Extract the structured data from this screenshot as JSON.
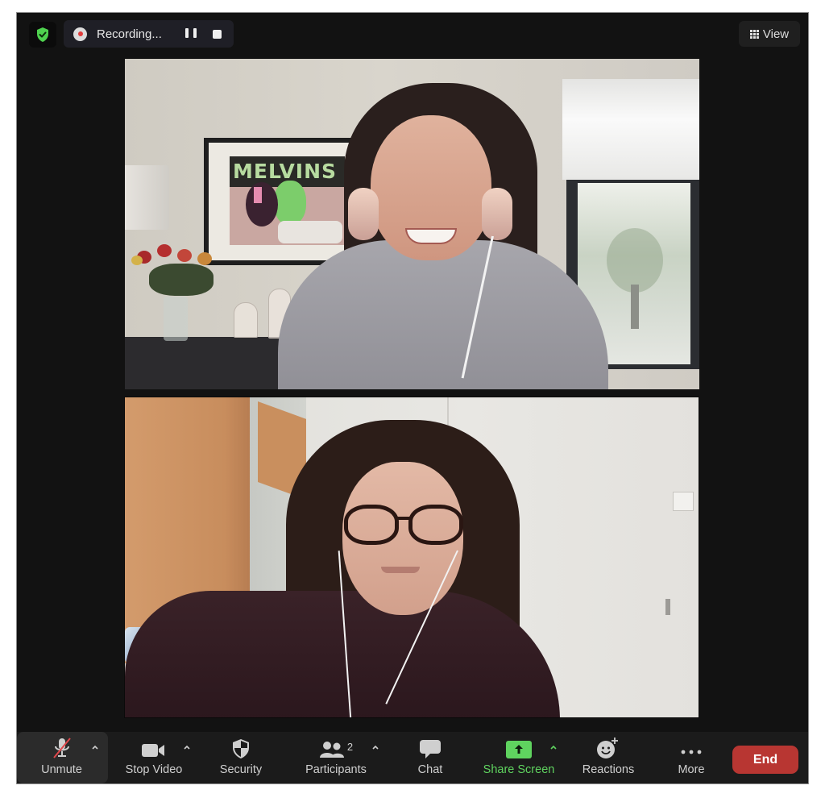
{
  "topbar": {
    "security_status": "encrypted",
    "recording": {
      "label": "Recording...",
      "pause_action": "pause-recording",
      "stop_action": "stop-recording"
    },
    "view_label": "View"
  },
  "videos": [
    {
      "participant": "participant-1",
      "scene": "woman with headphones smiling, living room with framed poster, roses, window",
      "poster_text": "MELVINS"
    },
    {
      "participant": "participant-2",
      "scene": "woman with glasses and earphones, room with wooden wardrobe and white wall"
    }
  ],
  "toolbar": {
    "items": [
      {
        "id": "unmute",
        "label": "Unmute",
        "icon": "microphone-muted-icon",
        "has_caret": true
      },
      {
        "id": "stop-video",
        "label": "Stop Video",
        "icon": "video-camera-icon",
        "has_caret": true
      },
      {
        "id": "security",
        "label": "Security",
        "icon": "shield-icon",
        "has_caret": false
      },
      {
        "id": "participants",
        "label": "Participants",
        "icon": "participants-icon",
        "count": "2",
        "has_caret": true
      },
      {
        "id": "chat",
        "label": "Chat",
        "icon": "chat-bubble-icon",
        "has_caret": false
      },
      {
        "id": "share-screen",
        "label": "Share Screen",
        "icon": "share-arrow-icon",
        "has_caret": true
      },
      {
        "id": "reactions",
        "label": "Reactions",
        "icon": "emoji-add-icon",
        "has_caret": false
      },
      {
        "id": "more",
        "label": "More",
        "icon": "ellipsis-icon",
        "has_caret": false
      }
    ],
    "end_label": "End"
  },
  "colors": {
    "window_bg": "#121212",
    "toolbar_bg": "#1b1b1b",
    "accent_green": "#5fd35f",
    "end_red": "#b83632",
    "record_red": "#e23c3c"
  }
}
